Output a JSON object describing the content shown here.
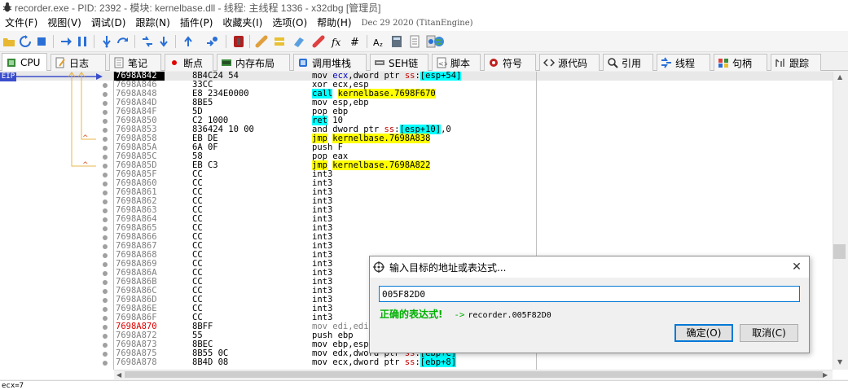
{
  "window": {
    "title": "recorder.exe - PID: 2392 - 模块: kernelbase.dll - 线程: 主线程 1336 - x32dbg [管理员]"
  },
  "menu": {
    "items": [
      "文件(F)",
      "视图(V)",
      "调试(D)",
      "跟踪(N)",
      "插件(P)",
      "收藏夹(I)",
      "选项(O)",
      "帮助(H)"
    ],
    "build_date": "Dec 29 2020 (TitanEngine)"
  },
  "tabs": [
    {
      "label": "CPU",
      "icon": "cpu-icon"
    },
    {
      "label": "日志",
      "icon": "log-icon"
    },
    {
      "label": "笔记",
      "icon": "notes-icon"
    },
    {
      "label": "断点",
      "icon": "breakpoint-icon"
    },
    {
      "label": "内存布局",
      "icon": "memory-map-icon"
    },
    {
      "label": "调用堆栈",
      "icon": "call-stack-icon"
    },
    {
      "label": "SEH链",
      "icon": "seh-icon"
    },
    {
      "label": "脚本",
      "icon": "script-icon"
    },
    {
      "label": "符号",
      "icon": "symbols-icon"
    },
    {
      "label": "源代码",
      "icon": "source-icon"
    },
    {
      "label": "引用",
      "icon": "references-icon"
    },
    {
      "label": "线程",
      "icon": "threads-icon"
    },
    {
      "label": "句柄",
      "icon": "handles-icon"
    },
    {
      "label": "跟踪",
      "icon": "trace-icon"
    }
  ],
  "disasm": {
    "eip_label": "EIP",
    "rows": [
      {
        "addr": "7698A842",
        "bytes": "8B4C24 54",
        "seg": [
          {
            "t": "mov "
          },
          {
            "t": "ecx",
            "c": "blue"
          },
          {
            "t": ",dword ptr "
          },
          {
            "t": "ss",
            "c": "red"
          },
          {
            "t": ":"
          },
          {
            "t": "[esp+54]",
            "c": "hlc"
          }
        ],
        "sel": true
      },
      {
        "addr": "7698A846",
        "bytes": "33CC",
        "seg": [
          {
            "t": "xor ecx,esp"
          }
        ]
      },
      {
        "addr": "7698A848",
        "bytes": "E8 234E0000",
        "seg": [
          {
            "t": "call",
            "c": "hlc"
          },
          {
            "t": " "
          },
          {
            "t": "kernelbase.7698F670",
            "c": "hly"
          }
        ]
      },
      {
        "addr": "7698A84D",
        "bytes": "8BE5",
        "seg": [
          {
            "t": "mov esp,ebp"
          }
        ]
      },
      {
        "addr": "7698A84F",
        "bytes": "5D",
        "seg": [
          {
            "t": "pop ebp"
          }
        ]
      },
      {
        "addr": "7698A850",
        "bytes": "C2 1000",
        "seg": [
          {
            "t": "ret",
            "c": "hlc"
          },
          {
            "t": " 10"
          }
        ]
      },
      {
        "addr": "7698A853",
        "bytes": "836424 10 00",
        "seg": [
          {
            "t": "and dword ptr "
          },
          {
            "t": "ss",
            "c": "red"
          },
          {
            "t": ":"
          },
          {
            "t": "[esp+10]",
            "c": "hlc"
          },
          {
            "t": ",0"
          }
        ]
      },
      {
        "addr": "7698A858",
        "bytes": "EB DE",
        "seg": [
          {
            "t": "jmp",
            "c": "hly"
          },
          {
            "t": " "
          },
          {
            "t": "kernelbase.7698A838",
            "c": "hly"
          }
        ],
        "arrow": true
      },
      {
        "addr": "7698A85A",
        "bytes": "6A 0F",
        "seg": [
          {
            "t": "push F"
          }
        ]
      },
      {
        "addr": "7698A85C",
        "bytes": "58",
        "seg": [
          {
            "t": "pop eax"
          }
        ]
      },
      {
        "addr": "7698A85D",
        "bytes": "EB C3",
        "seg": [
          {
            "t": "jmp",
            "c": "hly"
          },
          {
            "t": " "
          },
          {
            "t": "kernelbase.7698A822",
            "c": "hly"
          }
        ],
        "arrow": true
      },
      {
        "addr": "7698A85F",
        "bytes": "CC",
        "seg": [
          {
            "t": "int3"
          }
        ]
      },
      {
        "addr": "7698A860",
        "bytes": "CC",
        "seg": [
          {
            "t": "int3"
          }
        ]
      },
      {
        "addr": "7698A861",
        "bytes": "CC",
        "seg": [
          {
            "t": "int3"
          }
        ]
      },
      {
        "addr": "7698A862",
        "bytes": "CC",
        "seg": [
          {
            "t": "int3"
          }
        ]
      },
      {
        "addr": "7698A863",
        "bytes": "CC",
        "seg": [
          {
            "t": "int3"
          }
        ]
      },
      {
        "addr": "7698A864",
        "bytes": "CC",
        "seg": [
          {
            "t": "int3"
          }
        ]
      },
      {
        "addr": "7698A865",
        "bytes": "CC",
        "seg": [
          {
            "t": "int3"
          }
        ]
      },
      {
        "addr": "7698A866",
        "bytes": "CC",
        "seg": [
          {
            "t": "int3"
          }
        ]
      },
      {
        "addr": "7698A867",
        "bytes": "CC",
        "seg": [
          {
            "t": "int3"
          }
        ]
      },
      {
        "addr": "7698A868",
        "bytes": "CC",
        "seg": [
          {
            "t": "int3"
          }
        ]
      },
      {
        "addr": "7698A869",
        "bytes": "CC",
        "seg": [
          {
            "t": "int3"
          }
        ]
      },
      {
        "addr": "7698A86A",
        "bytes": "CC",
        "seg": [
          {
            "t": "int3"
          }
        ]
      },
      {
        "addr": "7698A86B",
        "bytes": "CC",
        "seg": [
          {
            "t": "int3"
          }
        ]
      },
      {
        "addr": "7698A86C",
        "bytes": "CC",
        "seg": [
          {
            "t": "int3"
          }
        ]
      },
      {
        "addr": "7698A86D",
        "bytes": "CC",
        "seg": [
          {
            "t": "int3"
          }
        ]
      },
      {
        "addr": "7698A86E",
        "bytes": "CC",
        "seg": [
          {
            "t": "int3"
          }
        ]
      },
      {
        "addr": "7698A86F",
        "bytes": "CC",
        "seg": [
          {
            "t": "int3"
          }
        ]
      },
      {
        "addr": "7698A870",
        "bytes": "8BFF",
        "seg": [
          {
            "t": "mov edi,edi",
            "c": "gray"
          }
        ],
        "red": true
      },
      {
        "addr": "7698A872",
        "bytes": "55",
        "seg": [
          {
            "t": "push ebp"
          }
        ]
      },
      {
        "addr": "7698A873",
        "bytes": "8BEC",
        "seg": [
          {
            "t": "mov ebp,esp"
          }
        ]
      },
      {
        "addr": "7698A875",
        "bytes": "8B55 0C",
        "seg": [
          {
            "t": "mov edx,dword ptr "
          },
          {
            "t": "ss",
            "c": "red"
          },
          {
            "t": ":"
          },
          {
            "t": "[ebp+C]",
            "c": "hlc"
          }
        ]
      },
      {
        "addr": "7698A878",
        "bytes": "8B4D 08",
        "seg": [
          {
            "t": "mov ecx,dword ptr "
          },
          {
            "t": "ss",
            "c": "red"
          },
          {
            "t": ":"
          },
          {
            "t": "[ebp+8]",
            "c": "hlc"
          }
        ]
      }
    ]
  },
  "status": {
    "text": "ecx=7"
  },
  "dialog": {
    "title": "输入目标的地址或表达式...",
    "input_value": "005F82D0",
    "result_ok": "正确的表达式!",
    "result_arrow": "->",
    "result_value": "recorder.005F82D0",
    "ok_label": "确定(O)",
    "cancel_label": "取消(C)"
  },
  "colors": {
    "accent": "#0078d7",
    "eip": "#3a4ecc",
    "ok_green": "#00b000",
    "jump_line": "#e8b44a"
  }
}
